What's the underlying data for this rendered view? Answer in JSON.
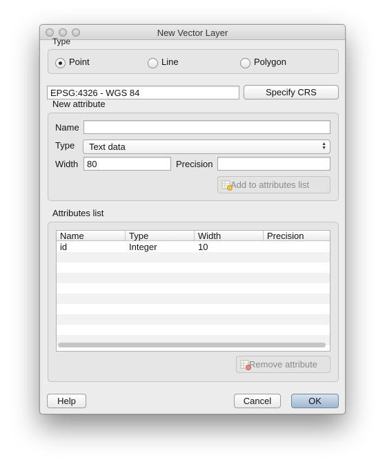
{
  "window": {
    "title": "New Vector Layer"
  },
  "type_group": {
    "title": "Type",
    "options": [
      {
        "label": "Point",
        "checked": true
      },
      {
        "label": "Line",
        "checked": false
      },
      {
        "label": "Polygon",
        "checked": false
      }
    ]
  },
  "crs": {
    "value": "EPSG:4326 - WGS 84",
    "button": "Specify CRS"
  },
  "new_attribute": {
    "title": "New attribute",
    "name_label": "Name",
    "name_value": "",
    "type_label": "Type",
    "type_value": "Text data",
    "width_label": "Width",
    "width_value": "80",
    "precision_label": "Precision",
    "precision_value": "",
    "add_button": "Add to attributes list"
  },
  "attributes_list": {
    "title": "Attributes list",
    "columns": [
      "Name",
      "Type",
      "Width",
      "Precision"
    ],
    "rows": [
      {
        "name": "id",
        "type": "Integer",
        "width": "10",
        "precision": ""
      }
    ],
    "remove_button": "Remove attribute"
  },
  "footer": {
    "help": "Help",
    "cancel": "Cancel",
    "ok": "OK"
  }
}
